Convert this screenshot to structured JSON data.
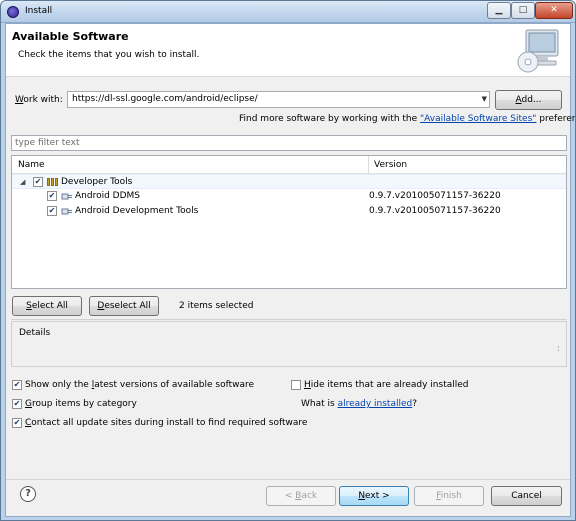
{
  "window": {
    "title": "Install"
  },
  "titlebar": {
    "minimize": "▁",
    "maximize": "□",
    "close": "✕"
  },
  "banner": {
    "title": "Available Software",
    "description": "Check the items that you wish to install."
  },
  "work_with": {
    "label_pre": "",
    "label_u": "W",
    "label_post": "ork with:",
    "value": "https://dl-ssl.google.com/android/eclipse/",
    "add_button_u": "A",
    "add_button_post": "dd..."
  },
  "find_more": {
    "text": "Find more software by working with the ",
    "link": "\"Available Software Sites\"",
    "suffix": " preferences."
  },
  "filter": {
    "placeholder": "type filter text"
  },
  "tree": {
    "columns": {
      "name": "Name",
      "version": "Version"
    },
    "items": [
      {
        "name": "Developer Tools",
        "version": "",
        "checked": true
      },
      {
        "name": "Android DDMS",
        "version": "0.9.7.v201005071157-36220",
        "checked": true
      },
      {
        "name": "Android Development Tools",
        "version": "0.9.7.v201005071157-36220",
        "checked": true
      }
    ]
  },
  "selection": {
    "select_all_u": "S",
    "select_all_post": "elect All",
    "deselect_all_u": "D",
    "deselect_all_post": "eselect All",
    "status": "2 items selected"
  },
  "details": {
    "label": "Details",
    "scroll": ":"
  },
  "options": {
    "latest_pre": "Show only the ",
    "latest_u": "l",
    "latest_post": "atest versions of available software",
    "group_u": "G",
    "group_post": "roup items by category",
    "contact_u": "C",
    "contact_post": "ontact all update sites during install to find required software",
    "hide_u": "H",
    "hide_post": "ide items that are already installed",
    "what_pre": "What is ",
    "what_link": "already installed",
    "what_post": "?"
  },
  "buttons": {
    "back_pre": "< ",
    "back_u": "B",
    "back_post": "ack",
    "next_u": "N",
    "next_post": "ext >",
    "finish_u": "F",
    "finish_post": "inish",
    "cancel": "Cancel"
  },
  "help": {
    "glyph": "?"
  }
}
